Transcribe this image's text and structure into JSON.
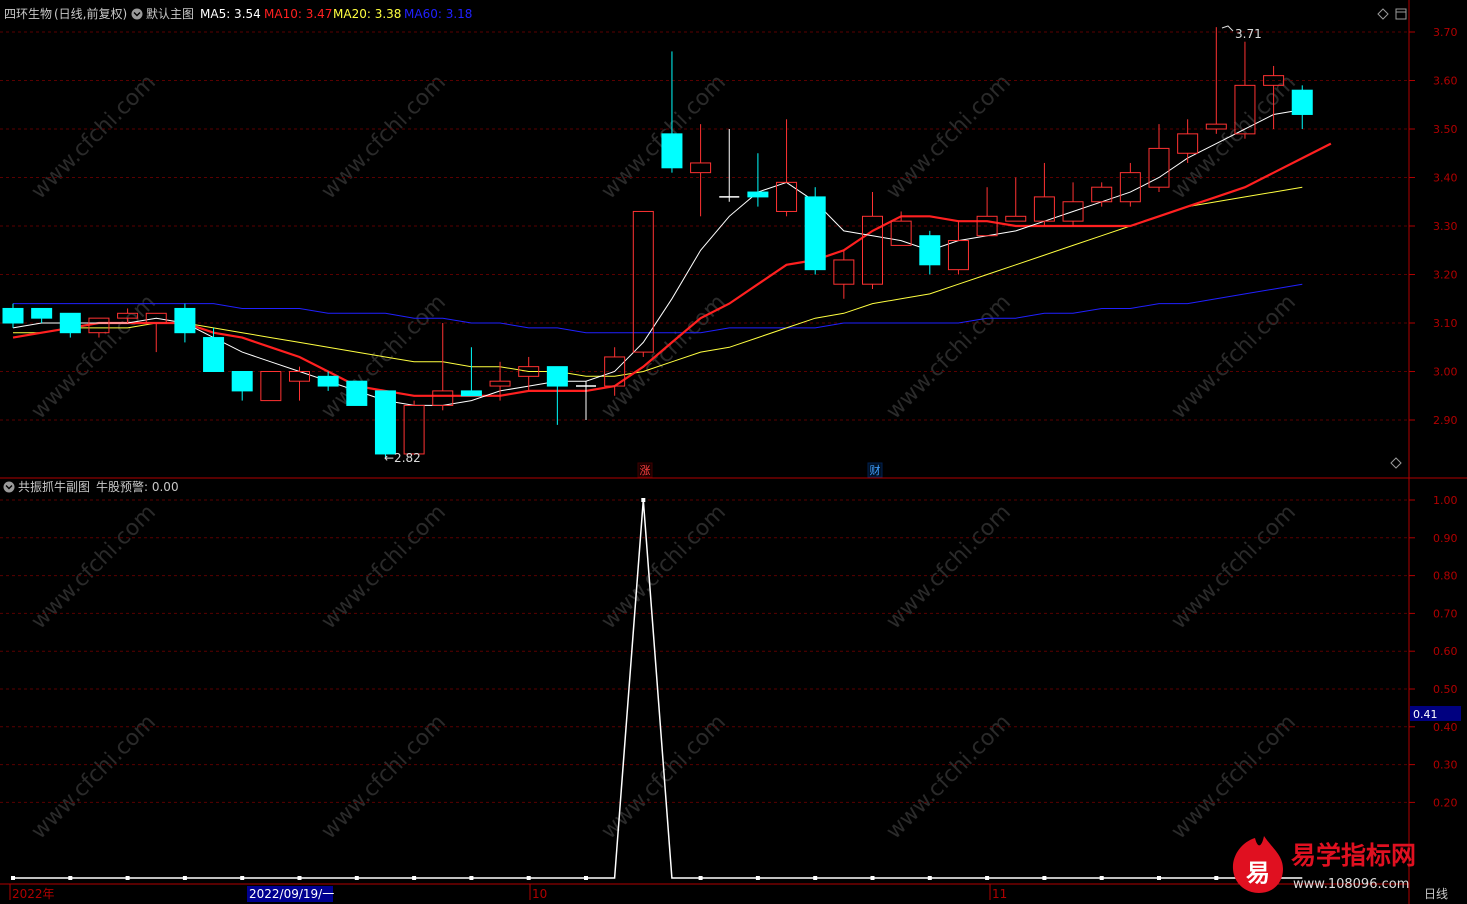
{
  "main_panel": {
    "stock_name": "四环生物",
    "period": "(日线,前复权)",
    "template_label": "默认主图",
    "ma_labels": [
      {
        "text": "MA5: 3.54",
        "color": "#ffffff"
      },
      {
        "text": "MA10: 3.47",
        "color": "#ff2020"
      },
      {
        "text": "MA20: 3.38",
        "color": "#ffff40"
      },
      {
        "text": "MA60: 3.18",
        "color": "#2020ff"
      }
    ],
    "high_label": "3.71",
    "low_label": "←2.82",
    "marker_zhang": "涨",
    "marker_cai": "财"
  },
  "sub_panel": {
    "title": "共振抓牛副图",
    "indicator_label": "牛股预警: 0.00",
    "current_value_tag": "0.41"
  },
  "bottom_bar": {
    "year_label": "2022年",
    "date_cursor": "2022/09/19/一",
    "month_10": "10",
    "month_11": "11",
    "period_button": "日线"
  },
  "watermark": {
    "text": "www.cfchi.com",
    "brand_char": "易",
    "brand_name": "易学指标网",
    "brand_url": "www.108096.com"
  },
  "chart_data": [
    {
      "type": "candlestick",
      "y_ticks": [
        "3.70",
        "3.60",
        "3.50",
        "3.40",
        "3.30",
        "3.20",
        "3.10",
        "3.00",
        "2.90"
      ],
      "ylim": [
        2.82,
        3.72
      ],
      "candles": [
        {
          "o": 3.13,
          "c": 3.1,
          "h": 3.14,
          "l": 3.09
        },
        {
          "o": 3.13,
          "c": 3.11,
          "h": 3.13,
          "l": 3.1
        },
        {
          "o": 3.12,
          "c": 3.08,
          "h": 3.12,
          "l": 3.07
        },
        {
          "o": 3.08,
          "c": 3.11,
          "h": 3.11,
          "l": 3.07
        },
        {
          "o": 3.11,
          "c": 3.12,
          "h": 3.13,
          "l": 3.1
        },
        {
          "o": 3.1,
          "c": 3.12,
          "h": 3.12,
          "l": 3.04
        },
        {
          "o": 3.13,
          "c": 3.08,
          "h": 3.14,
          "l": 3.06
        },
        {
          "o": 3.07,
          "c": 3.0,
          "h": 3.09,
          "l": 3.0
        },
        {
          "o": 3.0,
          "c": 2.96,
          "h": 3.0,
          "l": 2.94
        },
        {
          "o": 2.94,
          "c": 3.0,
          "h": 3.0,
          "l": 2.94
        },
        {
          "o": 2.98,
          "c": 3.0,
          "h": 3.01,
          "l": 2.94
        },
        {
          "o": 2.99,
          "c": 2.97,
          "h": 3.0,
          "l": 2.96
        },
        {
          "o": 2.98,
          "c": 2.93,
          "h": 2.98,
          "l": 2.93
        },
        {
          "o": 2.96,
          "c": 2.83,
          "h": 2.96,
          "l": 2.82
        },
        {
          "o": 2.83,
          "c": 2.93,
          "h": 2.94,
          "l": 2.83
        },
        {
          "o": 2.93,
          "c": 2.96,
          "h": 3.1,
          "l": 2.92
        },
        {
          "o": 2.96,
          "c": 2.95,
          "h": 3.05,
          "l": 2.95
        },
        {
          "o": 2.97,
          "c": 2.98,
          "h": 3.02,
          "l": 2.94
        },
        {
          "o": 2.99,
          "c": 3.01,
          "h": 3.03,
          "l": 2.96
        },
        {
          "o": 3.01,
          "c": 2.97,
          "h": 3.01,
          "l": 2.89
        },
        {
          "o": 2.97,
          "c": 2.97,
          "h": 2.98,
          "l": 2.9
        },
        {
          "o": 2.97,
          "c": 3.03,
          "h": 3.05,
          "l": 2.95
        },
        {
          "o": 3.04,
          "c": 3.33,
          "h": 3.33,
          "l": 3.03
        },
        {
          "o": 3.49,
          "c": 3.42,
          "h": 3.66,
          "l": 3.41
        },
        {
          "o": 3.41,
          "c": 3.43,
          "h": 3.51,
          "l": 3.32
        },
        {
          "o": 3.36,
          "c": 3.36,
          "h": 3.5,
          "l": 3.35
        },
        {
          "o": 3.37,
          "c": 3.36,
          "h": 3.45,
          "l": 3.34
        },
        {
          "o": 3.33,
          "c": 3.39,
          "h": 3.52,
          "l": 3.32
        },
        {
          "o": 3.36,
          "c": 3.21,
          "h": 3.38,
          "l": 3.2
        },
        {
          "o": 3.18,
          "c": 3.23,
          "h": 3.25,
          "l": 3.15
        },
        {
          "o": 3.18,
          "c": 3.32,
          "h": 3.37,
          "l": 3.17
        },
        {
          "o": 3.26,
          "c": 3.31,
          "h": 3.33,
          "l": 3.26
        },
        {
          "o": 3.28,
          "c": 3.22,
          "h": 3.29,
          "l": 3.2
        },
        {
          "o": 3.21,
          "c": 3.27,
          "h": 3.31,
          "l": 3.2
        },
        {
          "o": 3.28,
          "c": 3.32,
          "h": 3.38,
          "l": 3.28
        },
        {
          "o": 3.31,
          "c": 3.32,
          "h": 3.4,
          "l": 3.31
        },
        {
          "o": 3.31,
          "c": 3.36,
          "h": 3.43,
          "l": 3.3
        },
        {
          "o": 3.31,
          "c": 3.35,
          "h": 3.39,
          "l": 3.3
        },
        {
          "o": 3.35,
          "c": 3.38,
          "h": 3.39,
          "l": 3.34
        },
        {
          "o": 3.35,
          "c": 3.41,
          "h": 3.43,
          "l": 3.34
        },
        {
          "o": 3.38,
          "c": 3.46,
          "h": 3.51,
          "l": 3.37
        },
        {
          "o": 3.45,
          "c": 3.49,
          "h": 3.52,
          "l": 3.43
        },
        {
          "o": 3.5,
          "c": 3.51,
          "h": 3.71,
          "l": 3.49
        },
        {
          "o": 3.49,
          "c": 3.59,
          "h": 3.68,
          "l": 3.48
        },
        {
          "o": 3.59,
          "c": 3.61,
          "h": 3.63,
          "l": 3.5
        },
        {
          "o": 3.58,
          "c": 3.53,
          "h": 3.59,
          "l": 3.5
        }
      ],
      "series": [
        {
          "values": [
            3.09,
            3.1,
            3.1,
            3.1,
            3.1,
            3.11,
            3.1,
            3.07,
            3.04,
            3.02,
            3.0,
            2.98,
            2.96,
            2.94,
            2.93,
            2.93,
            2.94,
            2.96,
            2.97,
            2.98,
            2.98,
            3.0,
            3.06,
            3.15,
            3.25,
            3.32,
            3.37,
            3.39,
            3.35,
            3.29,
            3.28,
            3.27,
            3.25,
            3.27,
            3.28,
            3.29,
            3.31,
            3.33,
            3.35,
            3.37,
            3.4,
            3.44,
            3.47,
            3.5,
            3.53,
            3.54
          ]
        },
        {
          "values": [
            3.07,
            3.08,
            3.09,
            3.1,
            3.1,
            3.1,
            3.1,
            3.08,
            3.07,
            3.05,
            3.03,
            3.0,
            2.97,
            2.96,
            2.95,
            2.95,
            2.95,
            2.95,
            2.96,
            2.96,
            2.96,
            2.97,
            3.01,
            3.06,
            3.11,
            3.14,
            3.18,
            3.22,
            3.23,
            3.25,
            3.29,
            3.32,
            3.32,
            3.31,
            3.31,
            3.3,
            3.3,
            3.3,
            3.3,
            3.3,
            3.32,
            3.34,
            3.36,
            3.38,
            3.41,
            3.44,
            3.47
          ]
        },
        {
          "values": [
            3.08,
            3.08,
            3.09,
            3.09,
            3.09,
            3.1,
            3.1,
            3.09,
            3.08,
            3.07,
            3.06,
            3.05,
            3.04,
            3.03,
            3.02,
            3.02,
            3.01,
            3.01,
            3.0,
            3.0,
            2.99,
            2.99,
            3.0,
            3.02,
            3.04,
            3.05,
            3.07,
            3.09,
            3.11,
            3.12,
            3.14,
            3.15,
            3.16,
            3.18,
            3.2,
            3.22,
            3.24,
            3.26,
            3.28,
            3.3,
            3.32,
            3.34,
            3.35,
            3.36,
            3.37,
            3.38
          ]
        },
        {
          "values": [
            3.14,
            3.14,
            3.14,
            3.14,
            3.14,
            3.14,
            3.14,
            3.14,
            3.13,
            3.13,
            3.13,
            3.12,
            3.12,
            3.12,
            3.11,
            3.11,
            3.1,
            3.1,
            3.09,
            3.09,
            3.08,
            3.08,
            3.08,
            3.08,
            3.08,
            3.09,
            3.09,
            3.09,
            3.09,
            3.1,
            3.1,
            3.1,
            3.1,
            3.1,
            3.11,
            3.11,
            3.12,
            3.12,
            3.13,
            3.13,
            3.14,
            3.14,
            3.15,
            3.16,
            3.17,
            3.18
          ]
        }
      ]
    },
    {
      "type": "line",
      "y_ticks": [
        "1.00",
        "0.90",
        "0.80",
        "0.70",
        "0.60",
        "0.50",
        "0.40",
        "0.30",
        "0.20"
      ],
      "ylim": [
        0,
        1
      ],
      "values": [
        0,
        0,
        0,
        0,
        0,
        0,
        0,
        0,
        0,
        0,
        0,
        0,
        0,
        0,
        0,
        0,
        0,
        0,
        0,
        0,
        0,
        0,
        1,
        0,
        0,
        0,
        0,
        0,
        0,
        0,
        0,
        0,
        0,
        0,
        0,
        0,
        0,
        0,
        0,
        0,
        0,
        0,
        0,
        0,
        0,
        0
      ]
    }
  ]
}
